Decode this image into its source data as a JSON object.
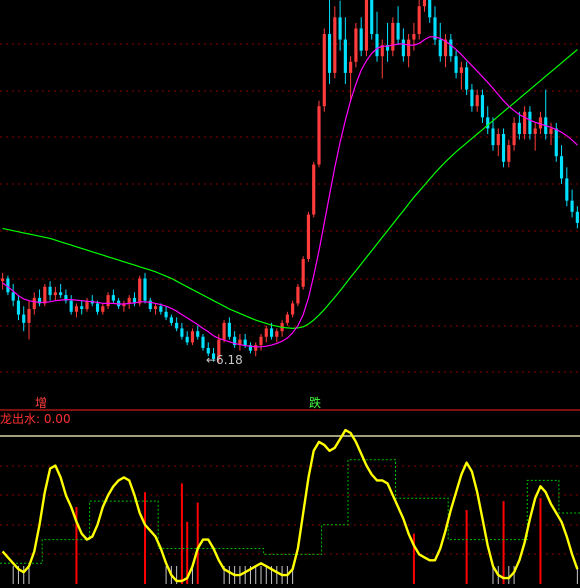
{
  "chart_data": [
    {
      "type": "candlestick",
      "title": "",
      "annotations": [
        {
          "text": "←6.18",
          "at_index": 41,
          "price": 6.18
        }
      ],
      "ylim": [
        5.8,
        13.0
      ],
      "grid": true,
      "colors": {
        "up": "#ff3c3c",
        "down": "#00e0ff",
        "ma_short": "#ff00ff",
        "ma_long": "#00ff00",
        "grid": "#8b0000"
      },
      "candles": [
        [
          7.65,
          7.8,
          7.5,
          7.7
        ],
        [
          7.7,
          7.75,
          7.4,
          7.45
        ],
        [
          7.45,
          7.6,
          7.2,
          7.3
        ],
        [
          7.3,
          7.4,
          6.95,
          7.05
        ],
        [
          7.05,
          7.2,
          6.75,
          6.9
        ],
        [
          6.9,
          7.3,
          6.6,
          7.15
        ],
        [
          7.15,
          7.45,
          7.05,
          7.35
        ],
        [
          7.35,
          7.5,
          7.2,
          7.25
        ],
        [
          7.25,
          7.6,
          7.2,
          7.55
        ],
        [
          7.55,
          7.65,
          7.3,
          7.4
        ],
        [
          7.4,
          7.55,
          7.3,
          7.45
        ],
        [
          7.45,
          7.6,
          7.35,
          7.4
        ],
        [
          7.4,
          7.5,
          7.25,
          7.3
        ],
        [
          7.3,
          7.4,
          7.05,
          7.1
        ],
        [
          7.1,
          7.25,
          7.0,
          7.2
        ],
        [
          7.2,
          7.3,
          7.05,
          7.15
        ],
        [
          7.15,
          7.35,
          7.1,
          7.3
        ],
        [
          7.3,
          7.4,
          7.2,
          7.25
        ],
        [
          7.25,
          7.3,
          7.05,
          7.1
        ],
        [
          7.1,
          7.25,
          7.05,
          7.2
        ],
        [
          7.2,
          7.45,
          7.15,
          7.4
        ],
        [
          7.4,
          7.5,
          7.25,
          7.3
        ],
        [
          7.3,
          7.35,
          7.15,
          7.2
        ],
        [
          7.2,
          7.3,
          7.1,
          7.25
        ],
        [
          7.25,
          7.4,
          7.15,
          7.35
        ],
        [
          7.35,
          7.45,
          7.2,
          7.25
        ],
        [
          7.25,
          7.75,
          7.2,
          7.7
        ],
        [
          7.7,
          7.8,
          7.25,
          7.3
        ],
        [
          7.3,
          7.35,
          7.1,
          7.15
        ],
        [
          7.15,
          7.25,
          7.05,
          7.2
        ],
        [
          7.2,
          7.25,
          7.05,
          7.1
        ],
        [
          7.1,
          7.2,
          6.95,
          7.0
        ],
        [
          7.0,
          7.05,
          6.85,
          6.9
        ],
        [
          6.9,
          7.0,
          6.75,
          6.8
        ],
        [
          6.8,
          6.9,
          6.6,
          6.65
        ],
        [
          6.65,
          6.75,
          6.5,
          6.55
        ],
        [
          6.55,
          6.8,
          6.5,
          6.75
        ],
        [
          6.75,
          6.85,
          6.6,
          6.65
        ],
        [
          6.65,
          6.7,
          6.4,
          6.45
        ],
        [
          6.45,
          6.55,
          6.3,
          6.35
        ],
        [
          6.35,
          6.45,
          6.2,
          6.25
        ],
        [
          6.25,
          6.7,
          6.18,
          6.6
        ],
        [
          6.6,
          6.95,
          6.55,
          6.9
        ],
        [
          6.9,
          7.0,
          6.6,
          6.65
        ],
        [
          6.65,
          6.75,
          6.45,
          6.5
        ],
        [
          6.5,
          6.7,
          6.4,
          6.6
        ],
        [
          6.6,
          6.7,
          6.45,
          6.5
        ],
        [
          6.5,
          6.55,
          6.35,
          6.4
        ],
        [
          6.4,
          6.55,
          6.3,
          6.5
        ],
        [
          6.5,
          6.7,
          6.4,
          6.65
        ],
        [
          6.65,
          6.85,
          6.55,
          6.8
        ],
        [
          6.8,
          6.9,
          6.6,
          6.65
        ],
        [
          6.65,
          6.8,
          6.55,
          6.75
        ],
        [
          6.75,
          6.95,
          6.65,
          6.9
        ],
        [
          6.9,
          7.1,
          6.85,
          7.05
        ],
        [
          7.05,
          7.3,
          7.0,
          7.25
        ],
        [
          7.25,
          7.6,
          7.2,
          7.55
        ],
        [
          7.55,
          8.1,
          7.5,
          8.05
        ],
        [
          8.05,
          8.9,
          8.0,
          8.85
        ],
        [
          8.85,
          9.8,
          8.8,
          9.75
        ],
        [
          9.75,
          10.9,
          9.7,
          10.8
        ],
        [
          10.8,
          12.2,
          10.7,
          12.1
        ],
        [
          12.1,
          13.3,
          11.2,
          11.4
        ],
        [
          11.4,
          12.6,
          11.3,
          12.4
        ],
        [
          12.4,
          12.7,
          11.8,
          12.0
        ],
        [
          12.0,
          12.4,
          11.2,
          11.4
        ],
        [
          11.4,
          11.7,
          10.9,
          11.6
        ],
        [
          11.6,
          12.3,
          11.5,
          12.2
        ],
        [
          12.2,
          12.4,
          11.7,
          11.8
        ],
        [
          11.8,
          13.3,
          11.7,
          12.9
        ],
        [
          12.9,
          13.1,
          12.0,
          12.1
        ],
        [
          12.1,
          12.5,
          11.6,
          11.7
        ],
        [
          11.7,
          12.0,
          11.3,
          11.9
        ],
        [
          11.9,
          12.3,
          11.6,
          11.8
        ],
        [
          11.8,
          12.4,
          11.7,
          12.3
        ],
        [
          12.3,
          12.6,
          11.9,
          12.0
        ],
        [
          12.0,
          12.2,
          11.6,
          11.7
        ],
        [
          11.7,
          12.1,
          11.5,
          12.0
        ],
        [
          12.0,
          12.3,
          11.8,
          12.1
        ],
        [
          12.1,
          12.8,
          12.0,
          12.6
        ],
        [
          12.6,
          13.3,
          12.5,
          13.2
        ],
        [
          13.2,
          13.3,
          12.3,
          12.4
        ],
        [
          12.4,
          12.6,
          11.9,
          12.0
        ],
        [
          12.0,
          12.3,
          11.6,
          11.7
        ],
        [
          11.7,
          12.1,
          11.5,
          12.0
        ],
        [
          12.0,
          12.1,
          11.6,
          11.7
        ],
        [
          11.7,
          11.8,
          11.3,
          11.4
        ],
        [
          11.4,
          11.6,
          11.1,
          11.5
        ],
        [
          11.5,
          11.6,
          11.0,
          11.1
        ],
        [
          11.1,
          11.2,
          10.7,
          10.8
        ],
        [
          10.8,
          11.1,
          10.7,
          11.0
        ],
        [
          11.0,
          11.1,
          10.5,
          10.6
        ],
        [
          10.6,
          10.8,
          10.3,
          10.4
        ],
        [
          10.4,
          10.6,
          10.0,
          10.1
        ],
        [
          10.1,
          10.4,
          9.9,
          10.3
        ],
        [
          10.3,
          10.4,
          9.7,
          9.8
        ],
        [
          9.8,
          10.2,
          9.7,
          10.1
        ],
        [
          10.1,
          10.6,
          10.0,
          10.5
        ],
        [
          10.5,
          10.7,
          10.2,
          10.3
        ],
        [
          10.3,
          10.8,
          10.2,
          10.7
        ],
        [
          10.7,
          10.8,
          10.2,
          10.3
        ],
        [
          10.3,
          10.5,
          10.0,
          10.4
        ],
        [
          10.4,
          10.7,
          10.3,
          10.6
        ],
        [
          10.6,
          11.1,
          10.2,
          10.3
        ],
        [
          10.3,
          10.5,
          10.1,
          10.4
        ],
        [
          10.4,
          10.5,
          9.8,
          9.9
        ],
        [
          9.9,
          10.1,
          9.4,
          9.5
        ],
        [
          9.5,
          9.7,
          9.0,
          9.1
        ],
        [
          9.1,
          9.3,
          8.8,
          8.9
        ],
        [
          8.9,
          9.0,
          8.6,
          8.7
        ]
      ],
      "ma_short": [
        7.62,
        7.55,
        7.47,
        7.39,
        7.33,
        7.3,
        7.28,
        7.27,
        7.27,
        7.28,
        7.3,
        7.31,
        7.32,
        7.32,
        7.31,
        7.3,
        7.29,
        7.28,
        7.27,
        7.25,
        7.25,
        7.25,
        7.24,
        7.24,
        7.25,
        7.26,
        7.28,
        7.28,
        7.27,
        7.25,
        7.23,
        7.2,
        7.16,
        7.11,
        7.05,
        6.99,
        6.93,
        6.87,
        6.8,
        6.74,
        6.67,
        6.62,
        6.59,
        6.56,
        6.53,
        6.51,
        6.49,
        6.48,
        6.47,
        6.47,
        6.48,
        6.5,
        6.53,
        6.57,
        6.63,
        6.72,
        6.85,
        7.05,
        7.35,
        7.75,
        8.2,
        8.7,
        9.2,
        9.7,
        10.15,
        10.55,
        10.9,
        11.2,
        11.45,
        11.62,
        11.75,
        11.84,
        11.88,
        11.88,
        11.9,
        11.92,
        11.92,
        11.9,
        11.9,
        11.93,
        12.0,
        12.05,
        12.05,
        12.02,
        11.97,
        11.9,
        11.82,
        11.73,
        11.63,
        11.53,
        11.43,
        11.33,
        11.23,
        11.12,
        11.01,
        10.9,
        10.8,
        10.72,
        10.65,
        10.6,
        10.55,
        10.51,
        10.48,
        10.45,
        10.42,
        10.38,
        10.33,
        10.27,
        10.19,
        10.1
      ],
      "ma_long": [
        8.6,
        8.58,
        8.56,
        8.54,
        8.52,
        8.5,
        8.48,
        8.46,
        8.44,
        8.42,
        8.39,
        8.36,
        8.33,
        8.3,
        8.27,
        8.24,
        8.21,
        8.18,
        8.15,
        8.12,
        8.09,
        8.06,
        8.03,
        8.0,
        7.97,
        7.94,
        7.91,
        7.88,
        7.85,
        7.82,
        7.78,
        7.74,
        7.7,
        7.65,
        7.6,
        7.55,
        7.5,
        7.45,
        7.4,
        7.35,
        7.3,
        7.25,
        7.2,
        7.15,
        7.11,
        7.07,
        7.03,
        6.99,
        6.95,
        6.92,
        6.89,
        6.86,
        6.84,
        6.82,
        6.81,
        6.8,
        6.81,
        6.83,
        6.88,
        6.95,
        7.04,
        7.14,
        7.25,
        7.36,
        7.48,
        7.6,
        7.72,
        7.84,
        7.96,
        8.08,
        8.2,
        8.32,
        8.44,
        8.56,
        8.68,
        8.8,
        8.92,
        9.04,
        9.16,
        9.27,
        9.38,
        9.49,
        9.6,
        9.7,
        9.8,
        9.89,
        9.98,
        10.06,
        10.14,
        10.22,
        10.3,
        10.38,
        10.46,
        10.54,
        10.62,
        10.7,
        10.78,
        10.86,
        10.94,
        11.02,
        11.1,
        11.18,
        11.26,
        11.34,
        11.42,
        11.5,
        11.58,
        11.66,
        11.74,
        11.82
      ]
    },
    {
      "type": "line",
      "title": "龙出水: 0.00",
      "labels": [
        {
          "text": "增",
          "color": "#ff4040"
        },
        {
          "text": "跌",
          "color": "#40ff40"
        }
      ],
      "ylim": [
        0,
        100
      ],
      "grid": true,
      "colors": {
        "main": "#ffff00",
        "step": "#00c000",
        "bars": "#ff0000",
        "ticks": "#c8c8c8",
        "ref": "#ffffc8"
      },
      "reference_level": 100,
      "yellow": [
        22,
        18,
        14,
        10,
        8,
        12,
        22,
        40,
        62,
        78,
        80,
        72,
        60,
        52,
        42,
        34,
        30,
        32,
        40,
        52,
        60,
        66,
        70,
        72,
        70,
        60,
        48,
        40,
        36,
        32,
        24,
        14,
        6,
        2,
        2,
        4,
        12,
        24,
        30,
        30,
        24,
        16,
        10,
        8,
        6,
        6,
        8,
        10,
        12,
        14,
        12,
        10,
        8,
        6,
        6,
        10,
        24,
        48,
        72,
        90,
        96,
        94,
        90,
        92,
        98,
        104,
        102,
        96,
        88,
        80,
        74,
        70,
        70,
        68,
        60,
        52,
        44,
        34,
        26,
        20,
        18,
        16,
        16,
        24,
        36,
        50,
        62,
        74,
        82,
        76,
        62,
        44,
        26,
        12,
        6,
        4,
        4,
        8,
        16,
        28,
        44,
        58,
        66,
        62,
        54,
        48,
        42,
        32,
        20,
        10
      ],
      "green": [
        14,
        14,
        14,
        14,
        14,
        14,
        14,
        14,
        30,
        30,
        30,
        30,
        30,
        30,
        30,
        30,
        30,
        56,
        56,
        56,
        56,
        56,
        56,
        56,
        56,
        56,
        56,
        56,
        56,
        56,
        24,
        24,
        24,
        24,
        24,
        24,
        24,
        24,
        24,
        24,
        24,
        24,
        24,
        24,
        24,
        24,
        24,
        24,
        24,
        24,
        20,
        20,
        20,
        20,
        20,
        20,
        20,
        20,
        20,
        20,
        20,
        40,
        40,
        40,
        40,
        40,
        84,
        84,
        84,
        84,
        84,
        84,
        84,
        84,
        84,
        58,
        58,
        58,
        58,
        58,
        58,
        58,
        58,
        58,
        58,
        30,
        30,
        30,
        30,
        30,
        30,
        30,
        30,
        30,
        30,
        30,
        30,
        30,
        30,
        30,
        70,
        70,
        70,
        70,
        70,
        70,
        48,
        48,
        48,
        48
      ],
      "bars": [
        {
          "index": 14,
          "value": 52
        },
        {
          "index": 27,
          "value": 62
        },
        {
          "index": 34,
          "value": 68
        },
        {
          "index": 35,
          "value": 42
        },
        {
          "index": 37,
          "value": 55
        },
        {
          "index": 78,
          "value": 34
        },
        {
          "index": 88,
          "value": 50
        },
        {
          "index": 95,
          "value": 56
        },
        {
          "index": 102,
          "value": 58
        }
      ]
    }
  ]
}
